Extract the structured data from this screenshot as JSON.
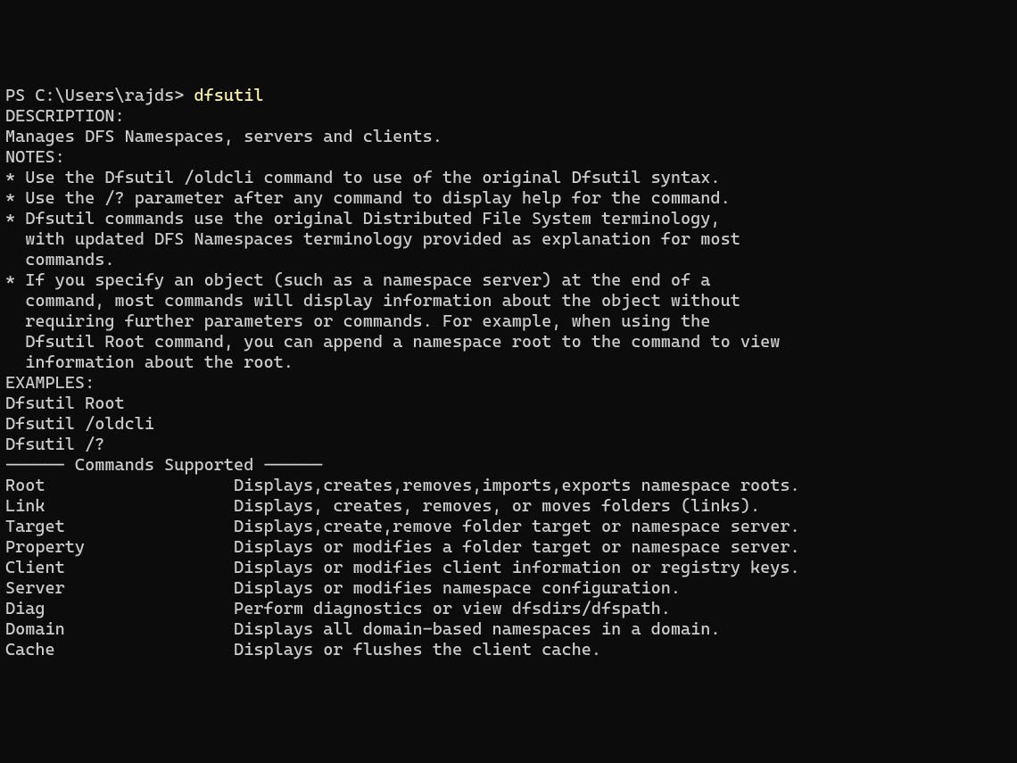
{
  "prompt": {
    "prefix": "PS C:\\Users\\rajds> ",
    "command": "dfsutil"
  },
  "blank1": "",
  "description_header": "DESCRIPTION:",
  "description_text": "Manages DFS Namespaces, servers and clients.",
  "blank2": "",
  "notes_header": "NOTES:",
  "notes": [
    "* Use the Dfsutil /oldcli command to use of the original Dfsutil syntax.",
    "* Use the /? parameter after any command to display help for the command.",
    "* Dfsutil commands use the original Distributed File System terminology,",
    "  with updated DFS Namespaces terminology provided as explanation for most",
    "  commands.",
    "* If you specify an object (such as a namespace server) at the end of a",
    "  command, most commands will display information about the object without",
    "  requiring further parameters or commands. For example, when using the",
    "  Dfsutil Root command, you can append a namespace root to the command to view",
    "  information about the root."
  ],
  "blank3": "",
  "examples_header": "EXAMPLES:",
  "examples": [
    "Dfsutil Root",
    "Dfsutil /oldcli",
    "Dfsutil /?"
  ],
  "blank4": "",
  "commands_header": "------ Commands Supported ------",
  "blank5": "",
  "commands": [
    "Root                   Displays,creates,removes,imports,exports namespace roots.",
    "Link                   Displays, creates, removes, or moves folders (links).",
    "Target                 Displays,create,remove folder target or namespace server.",
    "Property               Displays or modifies a folder target or namespace server.",
    "Client                 Displays or modifies client information or registry keys.",
    "Server                 Displays or modifies namespace configuration.",
    "Diag                   Perform diagnostics or view dfsdirs/dfspath.",
    "Domain                 Displays all domain-based namespaces in a domain.",
    "Cache                  Displays or flushes the client cache."
  ]
}
